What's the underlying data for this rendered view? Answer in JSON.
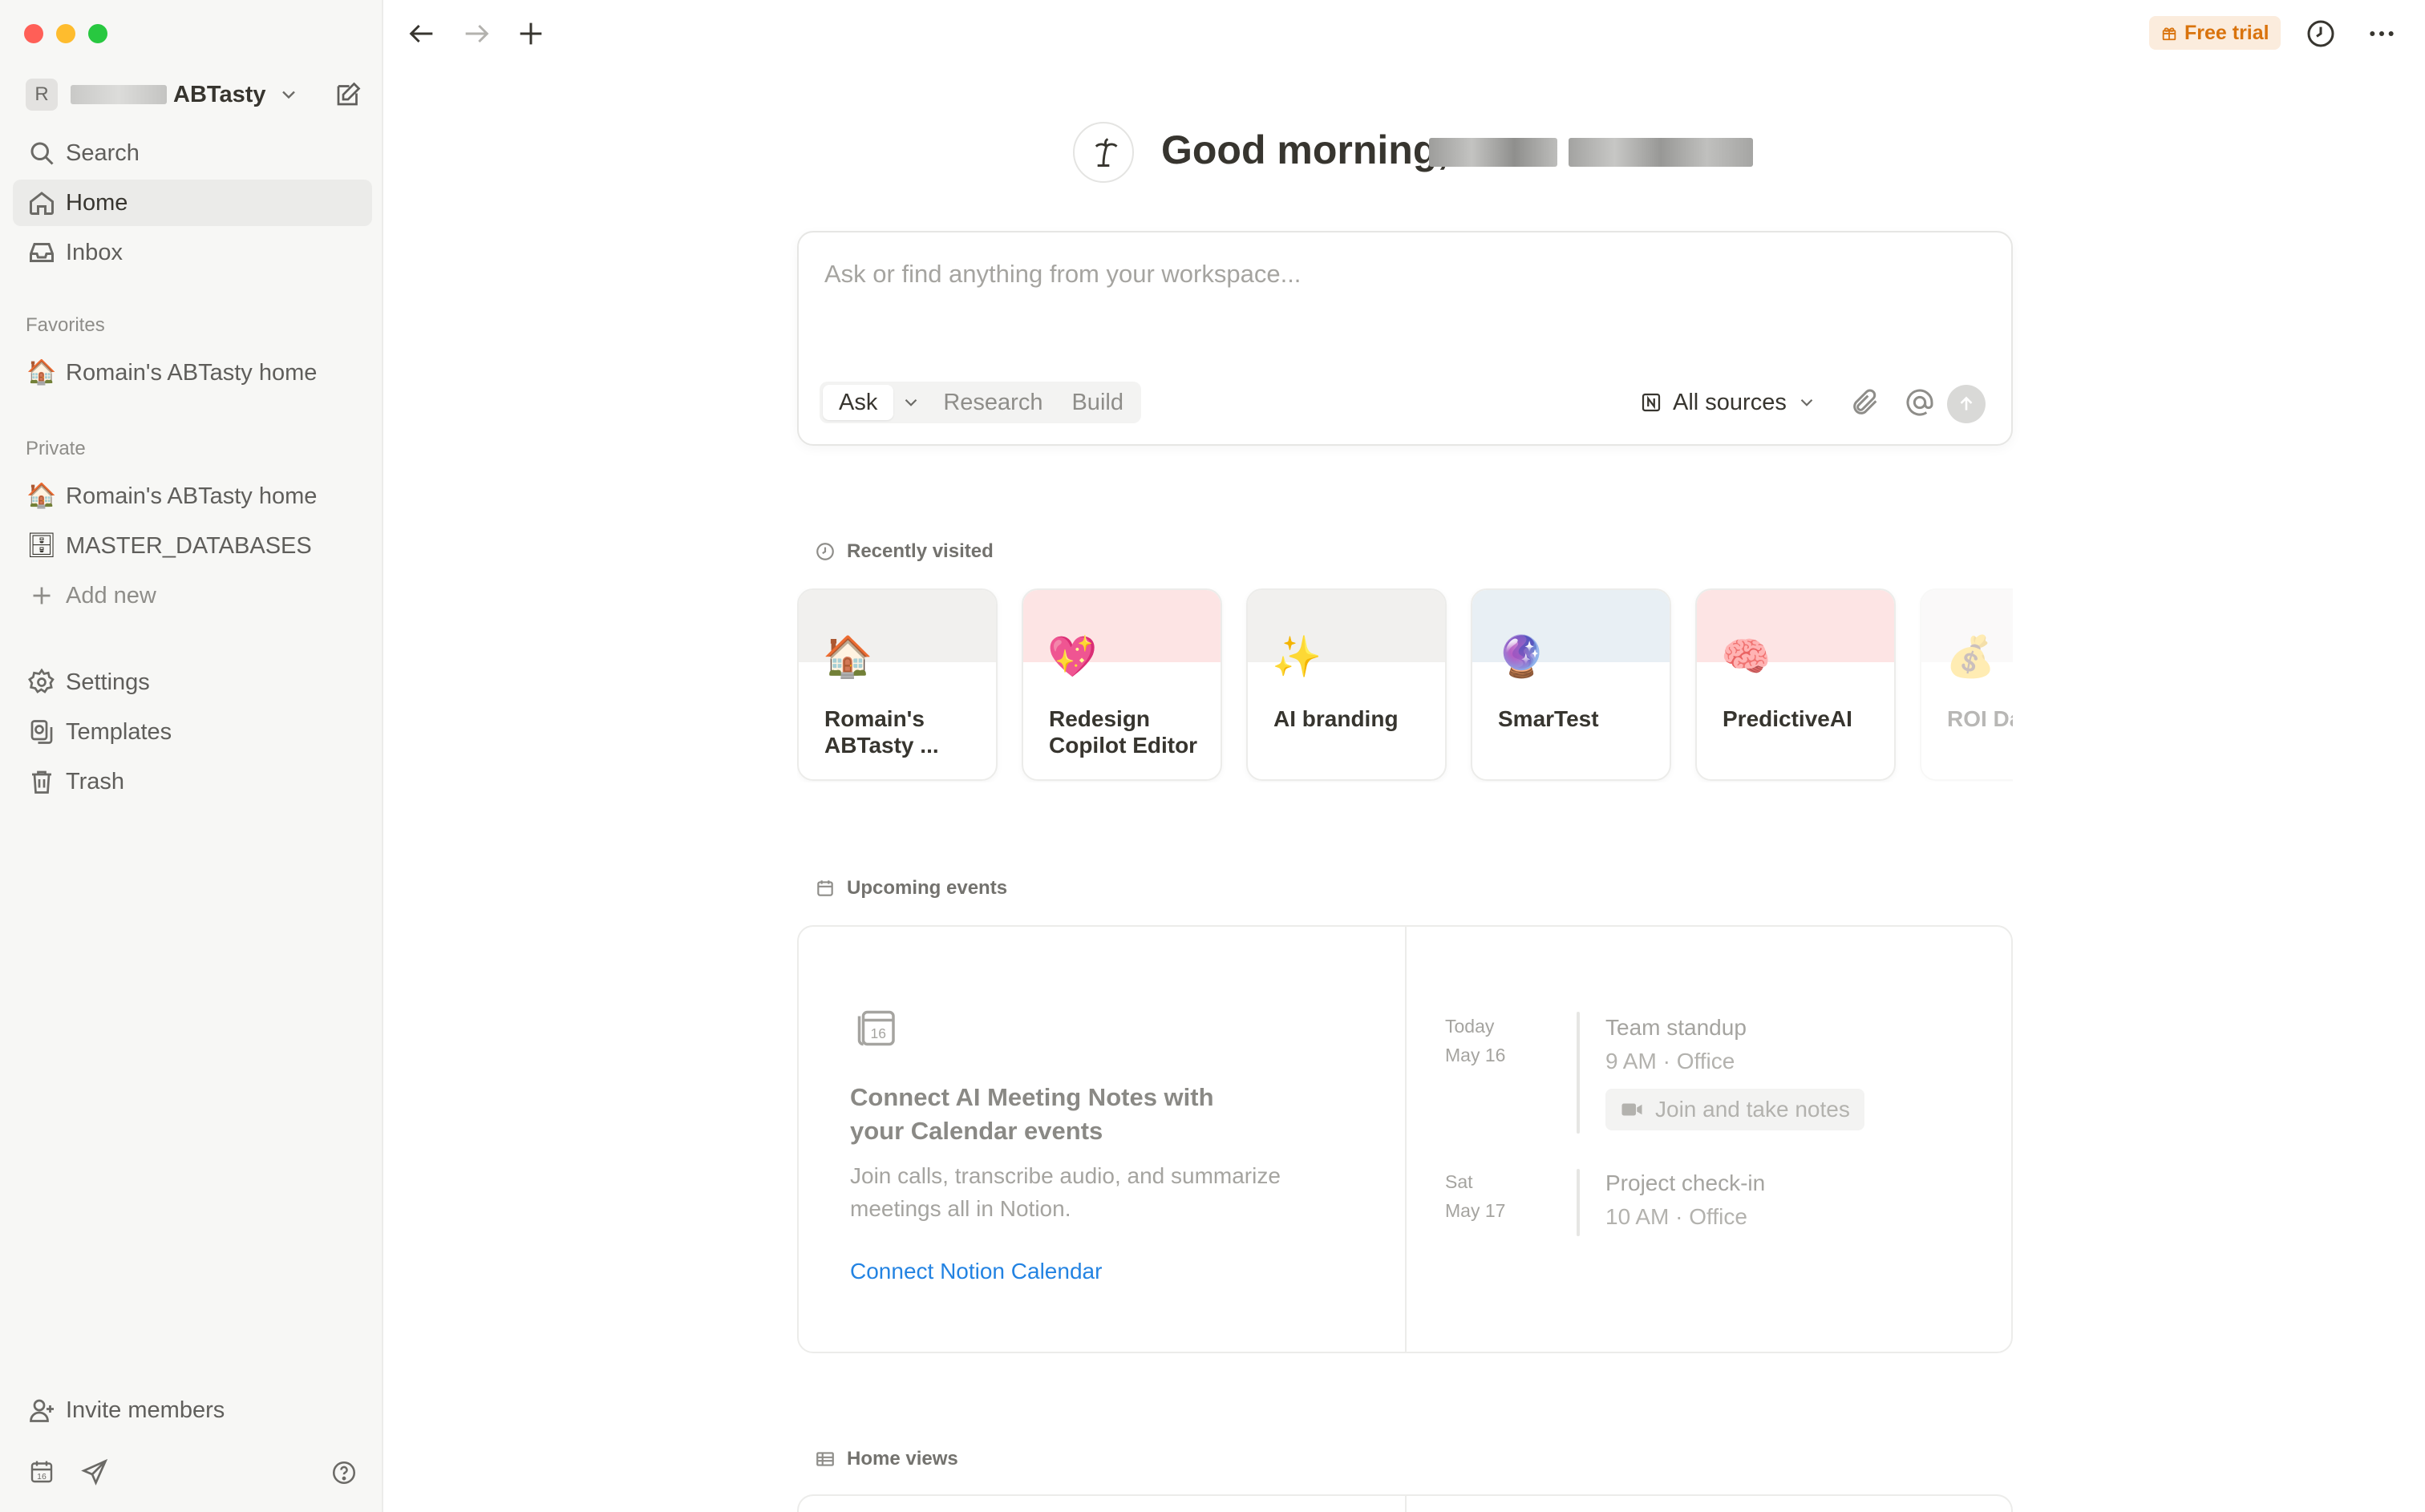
{
  "window": {
    "title": "Home"
  },
  "sidebar": {
    "workspace": {
      "avatar_letter": "R",
      "name": "ABTasty"
    },
    "nav": [
      {
        "label": "Search",
        "icon": "search-icon"
      },
      {
        "label": "Home",
        "icon": "home-icon",
        "active": true
      },
      {
        "label": "Inbox",
        "icon": "inbox-icon"
      }
    ],
    "favorites_header": "Favorites",
    "favorites": [
      {
        "label": "Romain's ABTasty home",
        "emoji": "🏠"
      }
    ],
    "private_header": "Private",
    "private": [
      {
        "label": "Romain's ABTasty home",
        "emoji": "🏠"
      },
      {
        "label": "MASTER_DATABASES",
        "emoji": "🗄"
      }
    ],
    "add_new": "Add new",
    "bottom_nav": [
      {
        "label": "Settings",
        "icon": "gear-icon"
      },
      {
        "label": "Templates",
        "icon": "templates-icon"
      },
      {
        "label": "Trash",
        "icon": "trash-icon"
      }
    ],
    "invite": "Invite members"
  },
  "topbar": {
    "free_trial": "Free trial"
  },
  "greeting": {
    "text": "Good morning,"
  },
  "ask": {
    "placeholder": "Ask or find anything from your workspace...",
    "modes": [
      "Ask",
      "Research",
      "Build"
    ],
    "sources": "All sources"
  },
  "recently_visited": {
    "header": "Recently visited",
    "cards": [
      {
        "title": "Romain's ABTasty ...",
        "emoji": "🏠",
        "cover": "#f1f0ee"
      },
      {
        "title": "Redesign Copilot Editor",
        "emoji": "💖",
        "cover": "#fde4e4"
      },
      {
        "title": "AI branding",
        "emoji": "✨",
        "cover": "#f1f0ee"
      },
      {
        "title": "SmarTest",
        "emoji": "🔮",
        "cover": "#e8eff4"
      },
      {
        "title": "PredictiveAI",
        "emoji": "🧠",
        "cover": "#fde4e4"
      },
      {
        "title": "ROI Dashb",
        "emoji": "💰",
        "cover": "#f1f0ee"
      }
    ]
  },
  "upcoming_events": {
    "header": "Upcoming events",
    "connect_title": "Connect AI Meeting Notes with your Calendar events",
    "connect_desc": "Join calls, transcribe audio, and summarize meetings all in Notion.",
    "connect_link": "Connect Notion Calendar",
    "events": [
      {
        "day": "Today",
        "date": "May 16",
        "name": "Team standup",
        "time": "9 AM · Office",
        "join": "Join and take notes"
      },
      {
        "day": "Sat",
        "date": "May 17",
        "name": "Project check-in",
        "time": "10 AM · Office"
      }
    ]
  },
  "home_views": {
    "header": "Home views"
  },
  "colors": {
    "accent_link": "#2383e2",
    "free_trial_bg": "#fbecdd",
    "free_trial_text": "#d9730d",
    "sidebar_bg": "#f7f7f5"
  }
}
